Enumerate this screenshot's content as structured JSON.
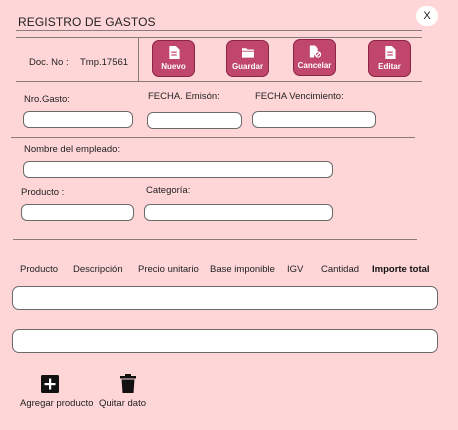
{
  "window": {
    "title": "REGISTRO DE GASTOS",
    "close_label": "X"
  },
  "doc": {
    "label": "Doc. No :",
    "value": "Tmp.17561"
  },
  "toolbar": {
    "nuevo": "Nuevo",
    "guardar": "Guardar",
    "cancelar": "Cancelar",
    "editar": "Editar"
  },
  "form": {
    "nro_gasto_label": "Nro.Gasto:",
    "nro_gasto_value": "",
    "fecha_emision_label": "FECHA. Emisón:",
    "fecha_emision_value": "",
    "fecha_venc_label": "FECHA Vencimiento:",
    "fecha_venc_value": "",
    "empleado_label": "Nombre del empleado:",
    "empleado_value": "",
    "producto_label": "Producto :",
    "producto_value": "",
    "categoria_label": "Categoría:",
    "categoria_value": ""
  },
  "table": {
    "columns": [
      "Producto",
      "Descripción",
      "Precio unitario",
      "Base imponible",
      "IGV",
      "Cantidad",
      "Importe total"
    ]
  },
  "actions": {
    "agregar": "Agregar producto",
    "quitar": "Quitar dato"
  },
  "colors": {
    "background": "#ffd6d8",
    "button": "#c0466c"
  }
}
